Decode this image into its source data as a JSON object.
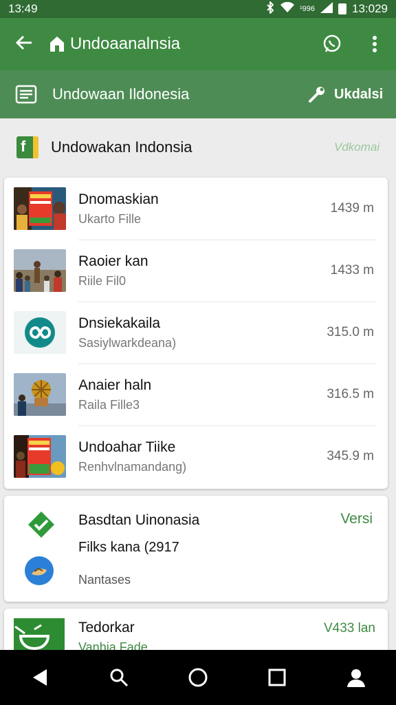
{
  "status_bar": {
    "time": "13:49",
    "network": "¹996",
    "clock_right": "13:029"
  },
  "app_bar": {
    "title": "Undoaanalnsia"
  },
  "sub_toolbar": {
    "title": "Undowaan Ildonesia",
    "action_label": "Ukdalsi"
  },
  "section_header": {
    "title": "Undowakan Indonsia",
    "meta": "Vdkomai"
  },
  "list": [
    {
      "title": "Dnomaskian",
      "subtitle": "Ukarto Fille",
      "distance": "1439 m",
      "thumb": "poster-thumbnail"
    },
    {
      "title": "Raoier kan",
      "subtitle": "Riile Fil0",
      "distance": "1433 m",
      "thumb": "crowd-photo-thumbnail"
    },
    {
      "title": "Dnsiekakaila",
      "subtitle": "Sasiylwarkdeana)",
      "distance": "315.0 m",
      "thumb": "infinity-logo-thumbnail"
    },
    {
      "title": "Anaier haln",
      "subtitle": "Raila Fille3",
      "distance": "316.5 m",
      "thumb": "sculpture-photo-thumbnail"
    },
    {
      "title": "Undoahar Tiike",
      "subtitle": "Renhvlnamandang)",
      "distance": "345.9 m",
      "thumb": "poster-thumbnail-2"
    }
  ],
  "info_card": {
    "title": "Basdtan Uinonasia",
    "line": "Filks kana (2917",
    "subtitle": "Nantases",
    "action": "Versi"
  },
  "partial_card": {
    "title": "Tedorkar",
    "subtitle": "Vanhia Fade",
    "meta": "V433 lan"
  },
  "colors": {
    "primary": "#3e8a42",
    "status_bar": "#2f6b33",
    "sub_toolbar": "#4e8c55",
    "accent_text": "#3e8a42"
  }
}
